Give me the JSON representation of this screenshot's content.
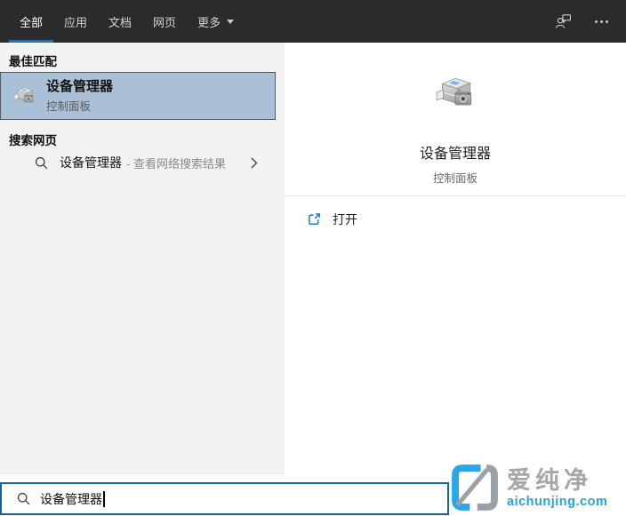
{
  "topbar": {
    "tabs": [
      {
        "label": "全部",
        "active": true
      },
      {
        "label": "应用",
        "active": false
      },
      {
        "label": "文档",
        "active": false
      },
      {
        "label": "网页",
        "active": false
      }
    ],
    "more": {
      "label": "更多",
      "dropdown_icon": "caret-down"
    },
    "feedback_icon": "person-with-chat-bubble",
    "more_options_icon": "ellipsis"
  },
  "left_panel": {
    "best_match_header": "最佳匹配",
    "best_match": {
      "title": "设备管理器",
      "subtitle": "控制面板",
      "icon": "device-manager-printer-camera"
    },
    "web_search_header": "搜索网页",
    "web_suggestion": {
      "query": "设备管理器",
      "hint": "- 查看网络搜索结果",
      "icon": "magnifier",
      "chevron_icon": "chevron-right"
    }
  },
  "right_panel": {
    "title": "设备管理器",
    "subtitle": "控制面板",
    "icon": "device-manager-printer-camera",
    "open_action": {
      "label": "打开",
      "icon": "open-external"
    }
  },
  "search_box": {
    "value": "设备管理器",
    "icon": "magnifier"
  },
  "watermark": {
    "brand": "爱纯净",
    "domain": "aichunjing.com"
  },
  "colors": {
    "accent": "#0f78d4",
    "topbar_bg": "#2b2b2b",
    "selection_bg": "#a9c0d7",
    "search_border": "#15639e",
    "watermark_blue": "#29a3e8",
    "watermark_gray": "#9aa2a8"
  }
}
